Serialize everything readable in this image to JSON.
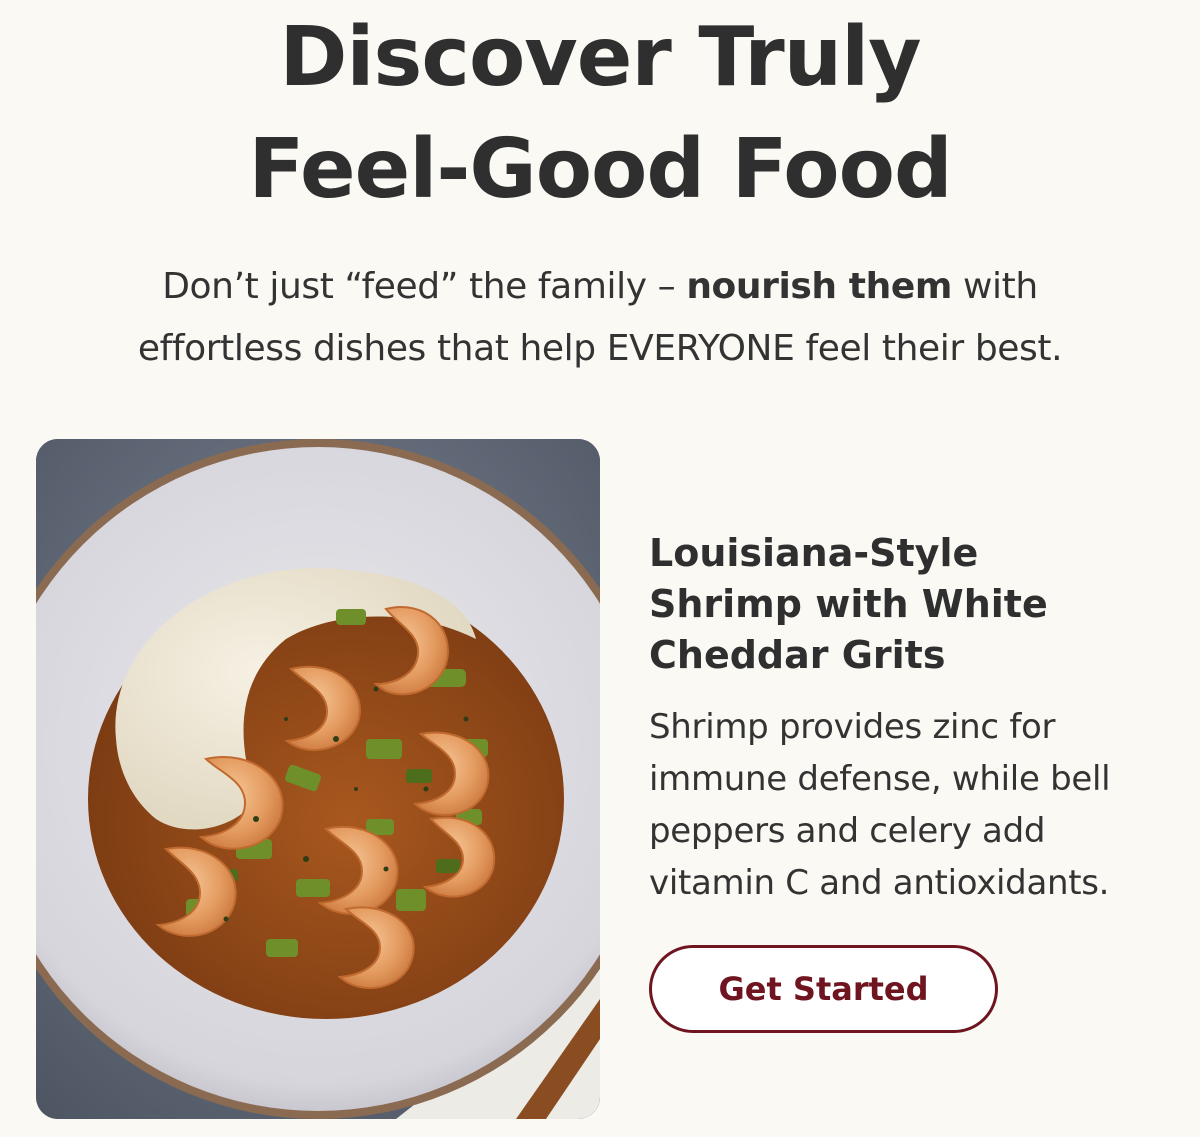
{
  "hero": {
    "headline_line1": "Discover Truly",
    "headline_line2": "Feel-Good Food",
    "subhead_part1": "Don’t just “feed” the family – ",
    "subhead_bold": "nourish them",
    "subhead_part2": " with",
    "subhead_line2": "effortless dishes that help EVERYONE feel their best."
  },
  "recipe": {
    "title_line1": "Louisiana-Style",
    "title_line2": "Shrimp with White",
    "title_line3": "Cheddar Grits",
    "desc_line1": "Shrimp provides zinc for",
    "desc_line2": "immune defense, while bell",
    "desc_line3": "peppers and celery add",
    "desc_line4": "vitamin C and antioxidants.",
    "cta_label": "Get Started"
  },
  "colors": {
    "background": "#fbf9f4",
    "text": "#2f2f2f",
    "accent": "#6f1520"
  }
}
